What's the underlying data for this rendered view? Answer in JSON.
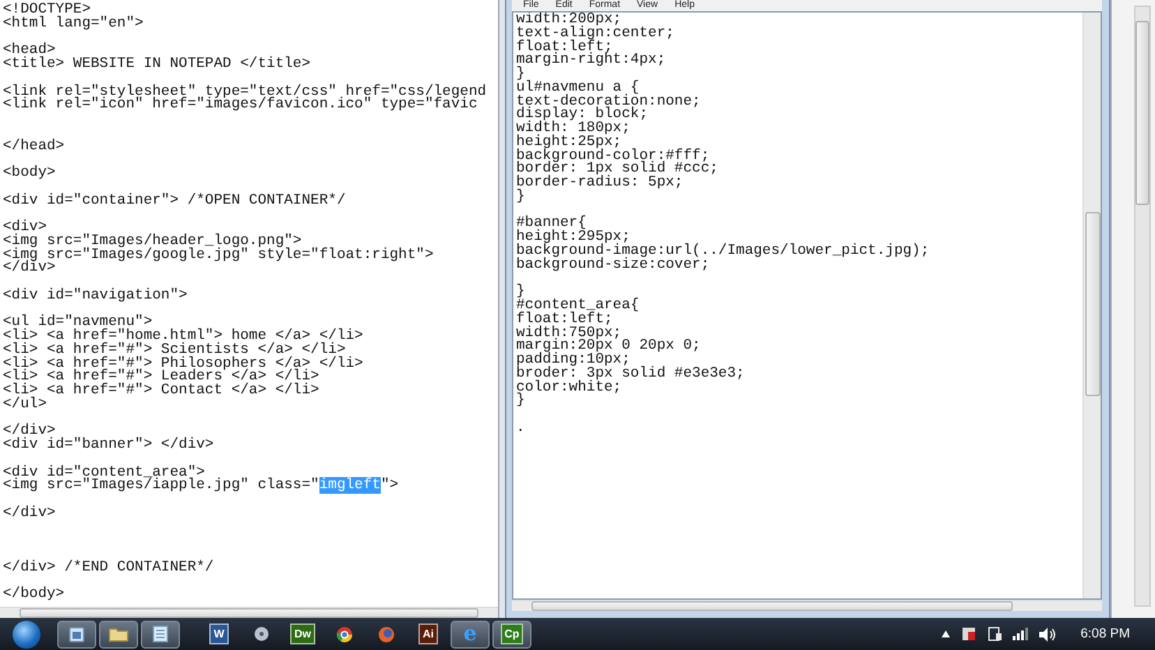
{
  "left_editor": {
    "blocks": [
      {
        "kind": "first",
        "lines": [
          "<!DOCTYPE>",
          "<html lang=\"en\">"
        ]
      },
      {
        "kind": "spaced",
        "lines": [
          "<head>",
          "<title> WEBSITE IN NOTEPAD </title>"
        ]
      },
      {
        "kind": "spaced",
        "lines": [
          "<link rel=\"stylesheet\" type=\"text/css\" href=\"css/legend",
          "<link rel=\"icon\" href=\"images/favicon.ico\" type=\"favic"
        ]
      },
      {
        "kind": "double",
        "lines": [
          "</head>"
        ]
      },
      {
        "kind": "spaced",
        "lines": [
          "<body>"
        ]
      },
      {
        "kind": "spaced",
        "lines": [
          "<div id=\"container\"> /*OPEN CONTAINER*/"
        ]
      },
      {
        "kind": "spaced",
        "lines": [
          "<div>",
          "<img src=\"Images/header_logo.png\">",
          "<img src=\"Images/google.jpg\" style=\"float:right\">",
          "</div>"
        ]
      },
      {
        "kind": "spaced",
        "lines": [
          "<div id=\"navigation\">"
        ]
      },
      {
        "kind": "spaced",
        "lines": [
          "<ul id=\"navmenu\">",
          "<li> <a href=\"home.html\"> home </a> </li>",
          "<li> <a href=\"#\"> Scientists </a> </li>",
          "<li> <a href=\"#\"> Philosophers </a> </li>",
          "<li> <a href=\"#\"> Leaders </a> </li>",
          "<li> <a href=\"#\"> Contact </a> </li>",
          "</ul>"
        ]
      },
      {
        "kind": "spaced",
        "lines": [
          "</div>",
          "<div id=\"banner\"> </div>"
        ]
      },
      {
        "kind": "spaced",
        "lines": [
          "<div id=\"content_area\">",
          {
            "segments": [
              {
                "text": "<img src=\"Images/iapple.jpg\" class=\"",
                "selected": false
              },
              {
                "text": "imgleft",
                "selected": true
              },
              {
                "text": "\">",
                "selected": false
              }
            ]
          }
        ]
      },
      {
        "kind": "spaced",
        "lines": [
          "</div>"
        ]
      },
      {
        "kind": "triple",
        "lines": [
          "</div> /*END CONTAINER*/"
        ]
      },
      {
        "kind": "spaced",
        "lines": [
          "</body>"
        ]
      }
    ]
  },
  "right_editor": {
    "menu": [
      "File",
      "Edit",
      "Format",
      "View",
      "Help"
    ],
    "blocks": [
      {
        "kind": "first",
        "lines": [
          "width:200px;",
          "text-align:center;",
          "float:left;",
          "margin-right:4px;",
          "}",
          "ul#navmenu a {",
          "text-decoration:none;",
          "display: block;",
          "width: 180px;",
          "height:25px;",
          "background-color:#fff;",
          "border: 1px solid #ccc;",
          "border-radius: 5px;",
          "}"
        ]
      },
      {
        "kind": "spaced",
        "lines": [
          "#banner{",
          "height:295px;",
          "background-image:url(../Images/lower_pict.jpg);",
          "background-size:cover;"
        ]
      },
      {
        "kind": "spaced",
        "lines": [
          "}",
          "#content_area{",
          "float:left;",
          "width:750px;",
          "margin:20px 0 20px 0;",
          "padding:10px;",
          "broder: 3px solid #e3e3e3;",
          "color:white;",
          "}"
        ]
      },
      {
        "kind": "spaced",
        "lines": [
          "."
        ]
      }
    ]
  },
  "taskbar": {
    "items": [
      {
        "kind": "start"
      },
      {
        "kind": "window",
        "open": true
      },
      {
        "kind": "folder",
        "open": true
      },
      {
        "kind": "notepad",
        "open": true
      },
      {
        "kind": "tile",
        "label": "W",
        "color": "#2b5797",
        "open": false
      },
      {
        "kind": "disc",
        "open": false
      },
      {
        "kind": "tile",
        "label": "Dw",
        "color": "#2f6b12",
        "open": false
      },
      {
        "kind": "pinwheel",
        "open": false
      },
      {
        "kind": "globe",
        "open": false
      },
      {
        "kind": "tile",
        "label": "Ai",
        "color": "#5a1d08",
        "open": false
      },
      {
        "kind": "letter",
        "label": "e",
        "open": true
      },
      {
        "kind": "tile",
        "label": "Cp",
        "color": "#2f7d1a",
        "open": true
      }
    ],
    "tray": [
      {
        "kind": "arrow"
      },
      {
        "kind": "flag"
      },
      {
        "kind": "device"
      },
      {
        "kind": "signal"
      },
      {
        "kind": "speaker"
      }
    ],
    "clock": "6:08 PM"
  }
}
